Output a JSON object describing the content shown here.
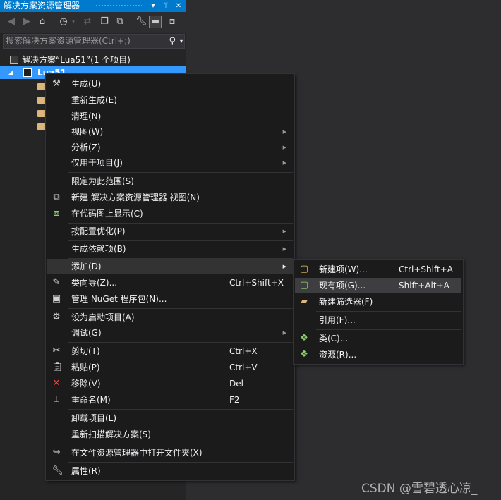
{
  "panel": {
    "title": "解决方案资源管理器",
    "title_buttons": [
      "▾",
      "ᛘ",
      "✕"
    ],
    "search_placeholder": "搜索解决方案资源管理器(Ctrl+;)",
    "solution_label": "解决方案“Lua51”(1 个项目)",
    "project_label": "Lua51"
  },
  "context_menu": {
    "items": [
      {
        "label": "生成(U)",
        "icon": "build-icon"
      },
      {
        "label": "重新生成(E)"
      },
      {
        "label": "清理(N)"
      },
      {
        "label": "视图(W)",
        "submenu": true
      },
      {
        "label": "分析(Z)",
        "submenu": true
      },
      {
        "label": "仅用于项目(J)",
        "submenu": true
      },
      {
        "label": "限定为此范围(S)"
      },
      {
        "label": "新建 解决方案资源管理器 视图(N)",
        "icon": "new-view-icon"
      },
      {
        "label": "在代码图上显示(C)",
        "icon": "code-map-icon"
      },
      {
        "label": "按配置优化(P)",
        "submenu": true
      },
      {
        "label": "生成依赖项(B)",
        "submenu": true
      },
      {
        "label": "添加(D)",
        "submenu": true
      },
      {
        "label": "类向导(Z)...",
        "shortcut": "Ctrl+Shift+X",
        "icon": "class-wizard-icon"
      },
      {
        "label": "管理 NuGet 程序包(N)...",
        "icon": "nuget-icon"
      },
      {
        "label": "设为启动项目(A)",
        "icon": "gear-icon"
      },
      {
        "label": "调试(G)",
        "submenu": true
      },
      {
        "label": "剪切(T)",
        "shortcut": "Ctrl+X",
        "icon": "cut-icon"
      },
      {
        "label": "粘贴(P)",
        "shortcut": "Ctrl+V",
        "icon": "paste-icon"
      },
      {
        "label": "移除(V)",
        "shortcut": "Del",
        "icon": "remove-icon"
      },
      {
        "label": "重命名(M)",
        "shortcut": "F2",
        "icon": "rename-icon"
      },
      {
        "label": "卸载项目(L)"
      },
      {
        "label": "重新扫描解决方案(S)"
      },
      {
        "label": "在文件资源管理器中打开文件夹(X)",
        "icon": "open-folder-icon"
      },
      {
        "label": "属性(R)",
        "icon": "wrench-icon"
      }
    ]
  },
  "add_submenu": {
    "items": [
      {
        "label": "新建项(W)...",
        "shortcut": "Ctrl+Shift+A"
      },
      {
        "label": "现有项(G)...",
        "shortcut": "Shift+Alt+A"
      },
      {
        "label": "新建筛选器(F)"
      },
      {
        "label": "引用(F)..."
      },
      {
        "label": "类(C)..."
      },
      {
        "label": "资源(R)..."
      }
    ]
  },
  "watermark": "CSDN @雪碧透心凉_",
  "colors": {
    "accent": "#007acc",
    "selection": "#3399ff",
    "menu_bg": "#1b1b1c",
    "panel_bg": "#252526",
    "editor_bg": "#2d2d30"
  }
}
